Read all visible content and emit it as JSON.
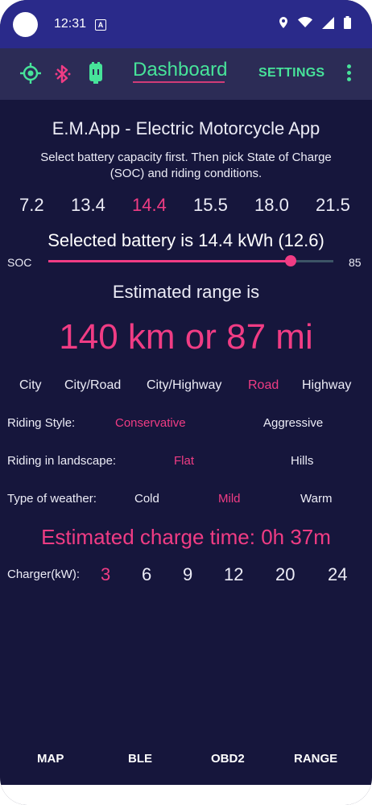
{
  "status_bar": {
    "time": "12:31",
    "badge": "A"
  },
  "app_bar": {
    "tab_title": "Dashboard",
    "settings_label": "SETTINGS"
  },
  "icons": {
    "gps": "crosshair-icon",
    "bluetooth": "bluetooth-icon",
    "battery": "battery-icon",
    "overflow": "more-vert-icon"
  },
  "colors": {
    "accent_green": "#47e39a",
    "accent_pink": "#f03c84",
    "background": "#16163c",
    "status_bar": "#2a2a8a"
  },
  "main": {
    "title": "E.M.App - Electric Motorcycle App",
    "instruction_line1": "Select battery capacity first. Then pick State of Charge",
    "instruction_line2": "(SOC) and riding conditions.",
    "battery_options": [
      "7.2",
      "13.4",
      "14.4",
      "15.5",
      "18.0",
      "21.5"
    ],
    "battery_selected_index": 2,
    "selected_battery_text": "Selected battery is 14.4 kWh (12.6)",
    "soc_label": "SOC",
    "soc_value": "85",
    "soc_fraction": 0.85,
    "range_label": "Estimated range is",
    "range_value": "140 km or 87 mi",
    "conditions": [
      "City",
      "City/Road",
      "City/Highway",
      "Road",
      "Highway"
    ],
    "condition_selected_index": 3,
    "riding_style": {
      "label": "Riding Style:",
      "options": [
        "Conservative",
        "Aggressive"
      ],
      "selected_index": 0
    },
    "landscape": {
      "label": "Riding in landscape:",
      "options": [
        "Flat",
        "Hills"
      ],
      "selected_index": 0
    },
    "weather": {
      "label": "Type of weather:",
      "options": [
        "Cold",
        "Mild",
        "Warm"
      ],
      "selected_index": 1
    },
    "charge_time": "Estimated charge time: 0h 37m",
    "charger": {
      "label": "Charger(kW):",
      "options": [
        "3",
        "6",
        "9",
        "12",
        "20",
        "24"
      ],
      "selected_index": 0
    }
  },
  "bottom_nav": [
    "MAP",
    "BLE",
    "OBD2",
    "RANGE"
  ]
}
